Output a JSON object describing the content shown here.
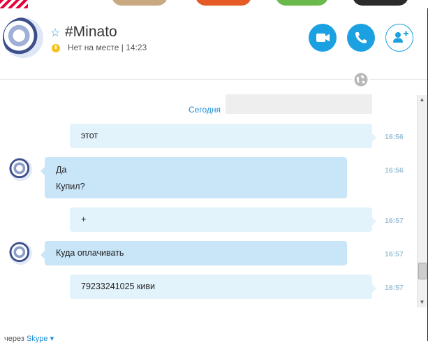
{
  "header": {
    "contact_name": "#Minato",
    "status_text": "Нет на месте | 14:23"
  },
  "chat": {
    "date_separator": "Сегодня",
    "messages": [
      {
        "direction": "out",
        "lines": [
          "этот"
        ],
        "time": "16:56"
      },
      {
        "direction": "in",
        "lines": [
          "Да",
          "Купил?"
        ],
        "time": "16:56"
      },
      {
        "direction": "out",
        "lines": [
          "+"
        ],
        "time": "16:57"
      },
      {
        "direction": "in",
        "lines": [
          "Куда оплачивать"
        ],
        "time": "16:57"
      },
      {
        "direction": "out",
        "lines": [
          "79233241025 киви"
        ],
        "time": "16:57"
      }
    ]
  },
  "footer": {
    "via_label": "через",
    "service_label": "Skype"
  },
  "icons": {
    "favorite": "star-outline-icon",
    "presence": "clock-icon",
    "video_call": "video-camera-icon",
    "audio_call": "phone-icon",
    "add_people": "add-person-icon",
    "translator": "globe-icon",
    "service_menu": "chevron-down-icon"
  },
  "colors": {
    "accent": "#1ba1e2",
    "incoming_bubble": "#c9e6f9",
    "outgoing_bubble": "#e3f3fc",
    "away_status": "#f6c21c",
    "timestamp": "#9fc2d8"
  }
}
